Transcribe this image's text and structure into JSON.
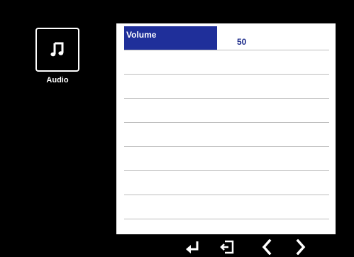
{
  "sidebar": {
    "category": {
      "label": "Audio",
      "icon": "music-note-icon"
    }
  },
  "menu": {
    "rows": [
      {
        "label": "Volume",
        "value": "50",
        "selected": true
      },
      {
        "label": "",
        "value": ""
      },
      {
        "label": "",
        "value": ""
      },
      {
        "label": "",
        "value": ""
      },
      {
        "label": "",
        "value": ""
      },
      {
        "label": "",
        "value": ""
      },
      {
        "label": "",
        "value": ""
      },
      {
        "label": "",
        "value": ""
      }
    ]
  },
  "navigation": {
    "buttons": [
      {
        "icon": "enter-icon"
      },
      {
        "icon": "exit-icon"
      },
      {
        "icon": "chevron-left-icon"
      },
      {
        "icon": "chevron-right-icon"
      }
    ]
  },
  "colors": {
    "background": "#000000",
    "panel": "#ffffff",
    "highlight": "#1f2f9a",
    "text_accent": "#1b2a8a",
    "divider": "#bdbdbd"
  }
}
